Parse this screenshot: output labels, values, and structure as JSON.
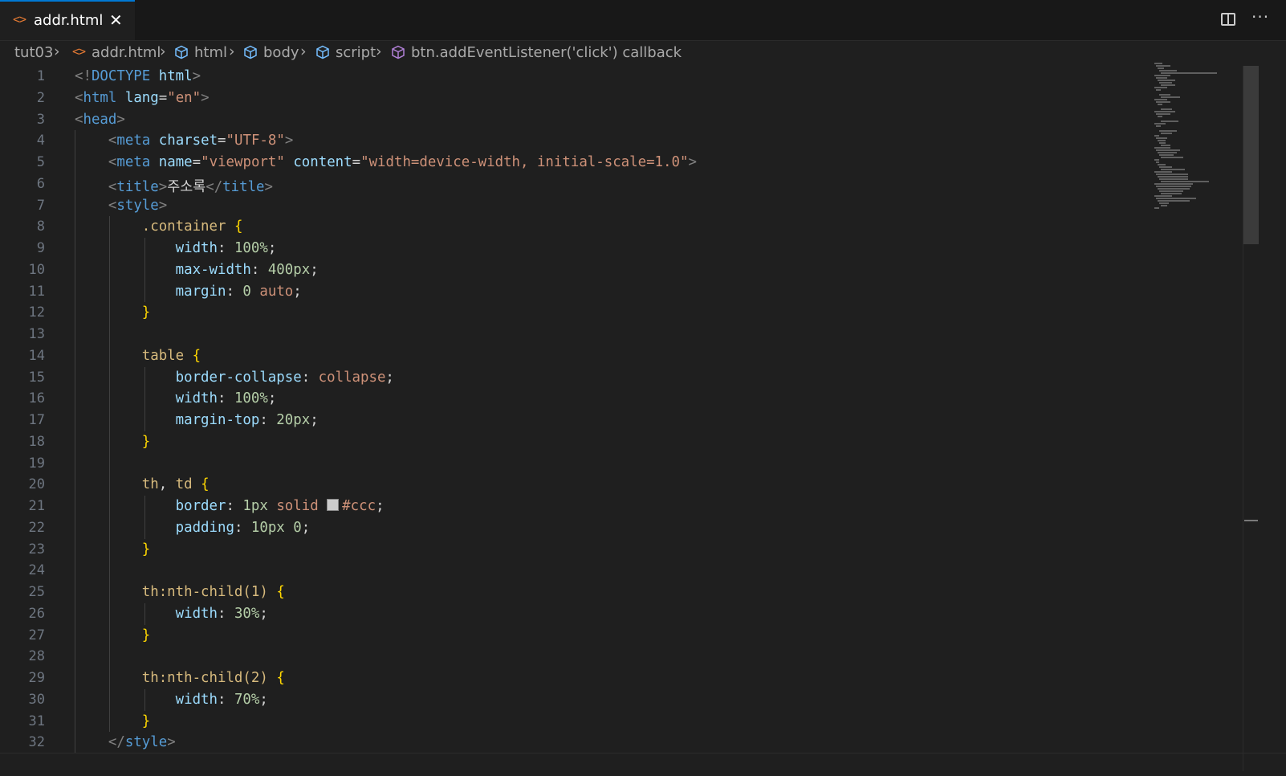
{
  "tab": {
    "icon": "code-file-icon",
    "label": "addr.html",
    "close": "✕"
  },
  "toolbar": {
    "split": "split-editor-icon",
    "more": "···"
  },
  "breadcrumb": {
    "items": [
      "tut03",
      "addr.html",
      "html",
      "body",
      "script",
      "btn.addEventListener('click') callback"
    ]
  },
  "colors": {
    "accent": "#0078d4",
    "background": "#1f1f1f",
    "tag": "#569cd6",
    "string": "#ce9178",
    "selector": "#d7ba7d",
    "property": "#9cdcfe",
    "number": "#b5cea8",
    "brace": "#ffd700"
  },
  "code": {
    "line_numbers": [
      "1",
      "2",
      "3",
      "4",
      "5",
      "6",
      "7",
      "8",
      "9",
      "10",
      "11",
      "12",
      "13",
      "14",
      "15",
      "16",
      "17",
      "18",
      "19",
      "20",
      "21",
      "22",
      "23",
      "24",
      "25",
      "26",
      "27",
      "28",
      "29",
      "30",
      "31",
      "32"
    ],
    "lines": [
      [
        [
          "br",
          "<!"
        ],
        [
          "tag",
          "DOCTYPE"
        ],
        [
          "txt",
          " "
        ],
        [
          "attr",
          "html"
        ],
        [
          "br",
          ">"
        ]
      ],
      [
        [
          "br",
          "<"
        ],
        [
          "tag",
          "html"
        ],
        [
          "txt",
          " "
        ],
        [
          "attr",
          "lang"
        ],
        [
          "txt",
          "="
        ],
        [
          "str",
          "\"en\""
        ],
        [
          "br",
          ">"
        ]
      ],
      [
        [
          "br",
          "<"
        ],
        [
          "tag",
          "head"
        ],
        [
          "br",
          ">"
        ]
      ],
      [
        [
          "txt",
          "    "
        ],
        [
          "br",
          "<"
        ],
        [
          "tag",
          "meta"
        ],
        [
          "txt",
          " "
        ],
        [
          "attr",
          "charset"
        ],
        [
          "txt",
          "="
        ],
        [
          "str",
          "\"UTF-8\""
        ],
        [
          "br",
          ">"
        ]
      ],
      [
        [
          "txt",
          "    "
        ],
        [
          "br",
          "<"
        ],
        [
          "tag",
          "meta"
        ],
        [
          "txt",
          " "
        ],
        [
          "attr",
          "name"
        ],
        [
          "txt",
          "="
        ],
        [
          "str",
          "\"viewport\""
        ],
        [
          "txt",
          " "
        ],
        [
          "attr",
          "content"
        ],
        [
          "txt",
          "="
        ],
        [
          "str",
          "\"width=device-width, initial-scale=1.0\""
        ],
        [
          "br",
          ">"
        ]
      ],
      [
        [
          "txt",
          "    "
        ],
        [
          "br",
          "<"
        ],
        [
          "tag",
          "title"
        ],
        [
          "br",
          ">"
        ],
        [
          "txt",
          "주소록"
        ],
        [
          "br",
          "</"
        ],
        [
          "tag",
          "title"
        ],
        [
          "br",
          ">"
        ]
      ],
      [
        [
          "txt",
          "    "
        ],
        [
          "br",
          "<"
        ],
        [
          "tag",
          "style"
        ],
        [
          "br",
          ">"
        ]
      ],
      [
        [
          "txt",
          "        "
        ],
        [
          "sel",
          ".container"
        ],
        [
          "txt",
          " "
        ],
        [
          "brace",
          "{"
        ]
      ],
      [
        [
          "txt",
          "            "
        ],
        [
          "prop",
          "width"
        ],
        [
          "punc",
          ": "
        ],
        [
          "num",
          "100%"
        ],
        [
          "punc",
          ";"
        ]
      ],
      [
        [
          "txt",
          "            "
        ],
        [
          "prop",
          "max-width"
        ],
        [
          "punc",
          ": "
        ],
        [
          "num",
          "400px"
        ],
        [
          "punc",
          ";"
        ]
      ],
      [
        [
          "txt",
          "            "
        ],
        [
          "prop",
          "margin"
        ],
        [
          "punc",
          ": "
        ],
        [
          "num",
          "0"
        ],
        [
          "txt",
          " "
        ],
        [
          "kw",
          "auto"
        ],
        [
          "punc",
          ";"
        ]
      ],
      [
        [
          "txt",
          "        "
        ],
        [
          "brace",
          "}"
        ]
      ],
      [],
      [
        [
          "txt",
          "        "
        ],
        [
          "sel",
          "table"
        ],
        [
          "txt",
          " "
        ],
        [
          "brace",
          "{"
        ]
      ],
      [
        [
          "txt",
          "            "
        ],
        [
          "prop",
          "border-collapse"
        ],
        [
          "punc",
          ": "
        ],
        [
          "kw",
          "collapse"
        ],
        [
          "punc",
          ";"
        ]
      ],
      [
        [
          "txt",
          "            "
        ],
        [
          "prop",
          "width"
        ],
        [
          "punc",
          ": "
        ],
        [
          "num",
          "100%"
        ],
        [
          "punc",
          ";"
        ]
      ],
      [
        [
          "txt",
          "            "
        ],
        [
          "prop",
          "margin-top"
        ],
        [
          "punc",
          ": "
        ],
        [
          "num",
          "20px"
        ],
        [
          "punc",
          ";"
        ]
      ],
      [
        [
          "txt",
          "        "
        ],
        [
          "brace",
          "}"
        ]
      ],
      [],
      [
        [
          "txt",
          "        "
        ],
        [
          "sel",
          "th"
        ],
        [
          "punc",
          ", "
        ],
        [
          "sel",
          "td"
        ],
        [
          "txt",
          " "
        ],
        [
          "brace",
          "{"
        ]
      ],
      [
        [
          "txt",
          "            "
        ],
        [
          "prop",
          "border"
        ],
        [
          "punc",
          ": "
        ],
        [
          "num",
          "1px"
        ],
        [
          "txt",
          " "
        ],
        [
          "kw",
          "solid"
        ],
        [
          "txt",
          " "
        ],
        [
          "swatch",
          ""
        ],
        [
          "kw",
          "#ccc"
        ],
        [
          "punc",
          ";"
        ]
      ],
      [
        [
          "txt",
          "            "
        ],
        [
          "prop",
          "padding"
        ],
        [
          "punc",
          ": "
        ],
        [
          "num",
          "10px"
        ],
        [
          "txt",
          " "
        ],
        [
          "num",
          "0"
        ],
        [
          "punc",
          ";"
        ]
      ],
      [
        [
          "txt",
          "        "
        ],
        [
          "brace",
          "}"
        ]
      ],
      [],
      [
        [
          "txt",
          "        "
        ],
        [
          "sel",
          "th:nth-child(1)"
        ],
        [
          "txt",
          " "
        ],
        [
          "brace",
          "{"
        ]
      ],
      [
        [
          "txt",
          "            "
        ],
        [
          "prop",
          "width"
        ],
        [
          "punc",
          ": "
        ],
        [
          "num",
          "30%"
        ],
        [
          "punc",
          ";"
        ]
      ],
      [
        [
          "txt",
          "        "
        ],
        [
          "brace",
          "}"
        ]
      ],
      [],
      [
        [
          "txt",
          "        "
        ],
        [
          "sel",
          "th:nth-child(2)"
        ],
        [
          "txt",
          " "
        ],
        [
          "brace",
          "{"
        ]
      ],
      [
        [
          "txt",
          "            "
        ],
        [
          "prop",
          "width"
        ],
        [
          "punc",
          ": "
        ],
        [
          "num",
          "70%"
        ],
        [
          "punc",
          ";"
        ]
      ],
      [
        [
          "txt",
          "        "
        ],
        [
          "brace",
          "}"
        ]
      ],
      [
        [
          "txt",
          "    "
        ],
        [
          "br",
          "</"
        ],
        [
          "tag",
          "style"
        ],
        [
          "br",
          ">"
        ]
      ]
    ]
  }
}
